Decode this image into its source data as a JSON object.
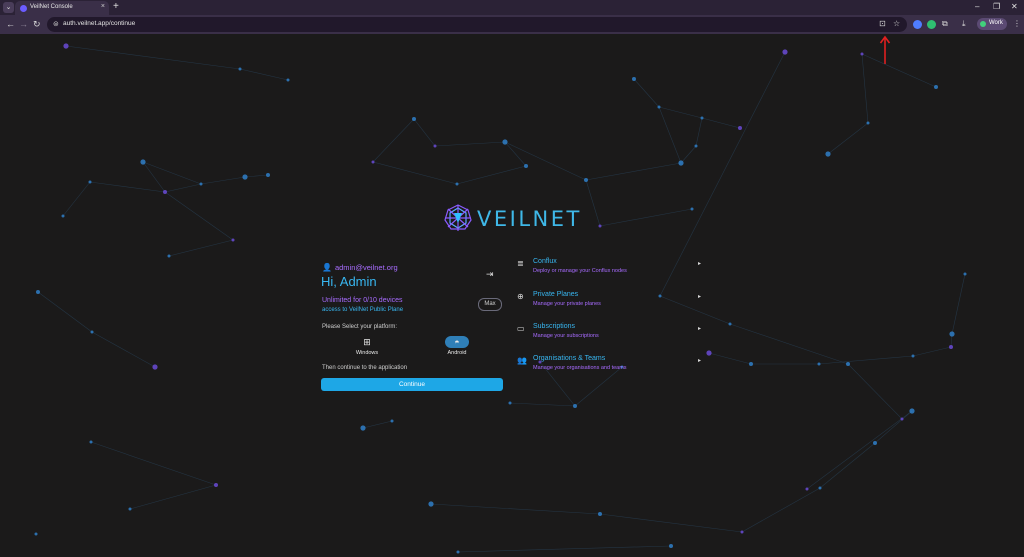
{
  "browser": {
    "tab": {
      "title": "VeilNet Console",
      "close_glyph": "×",
      "favicon": "veilnet-favicon"
    },
    "tab_list_glyph": "⌄",
    "new_tab_glyph": "+",
    "window_controls": {
      "minimize": "–",
      "restore": "❐",
      "close": "✕"
    },
    "nav": {
      "back": "←",
      "forward": "→",
      "reload": "↻"
    },
    "omnibox": {
      "url": "auth.veilnet.app/continue",
      "site_info_glyph": "⊜",
      "install_glyph": "⊡",
      "bookmark_glyph": "☆"
    },
    "extensions": [
      {
        "name": "extension-blue-icon",
        "color": "#4f7dff"
      },
      {
        "name": "extension-green-icon",
        "color": "#2fbf71"
      }
    ],
    "puzzle_glyph": "⧉",
    "download_glyph": "⤓",
    "menu_glyph": "⋮",
    "profile": {
      "label": "Work",
      "color": "#5b4a73"
    }
  },
  "colors": {
    "background": "#1b1a1a",
    "accent_blue": "#38b6f0",
    "accent_purple": "#a86cff",
    "button_blue": "#1ea7e6",
    "annotation_red": "#e02020"
  },
  "brand": {
    "name": "VEILNET"
  },
  "account": {
    "email": "admin@veilnet.org",
    "greeting": "Hi, Admin",
    "plan_title": "Unlimited for 0/10 devices",
    "plan_subtitle": "access to VeilNet Public Plane",
    "max_label": "Max",
    "logout_glyph": "⇥"
  },
  "platform": {
    "prompt": "Please Select your platform:",
    "options": [
      {
        "label": "Windows",
        "icon": "windows-icon",
        "glyph": "⊞",
        "selected": false
      },
      {
        "label": "Android",
        "icon": "android-icon",
        "glyph": "◓",
        "selected": true
      }
    ],
    "then_text": "Then continue to the application",
    "continue_label": "Continue"
  },
  "menu": {
    "chevron_glyph": "▸",
    "items": [
      {
        "title": "Conflux",
        "description": "Deploy or manage your Conflux nodes",
        "icon": "server-icon",
        "glyph": "≣"
      },
      {
        "title": "Private Planes",
        "description": "Manage your private planes",
        "icon": "globe-icon",
        "glyph": "⊕"
      },
      {
        "title": "Subscriptions",
        "description": "Manage your subscriptions",
        "icon": "card-icon",
        "glyph": "▭"
      },
      {
        "title": "Organisations & Teams",
        "description": "Manage your organisations and teams",
        "icon": "group-icon",
        "glyph": "👥"
      }
    ]
  }
}
